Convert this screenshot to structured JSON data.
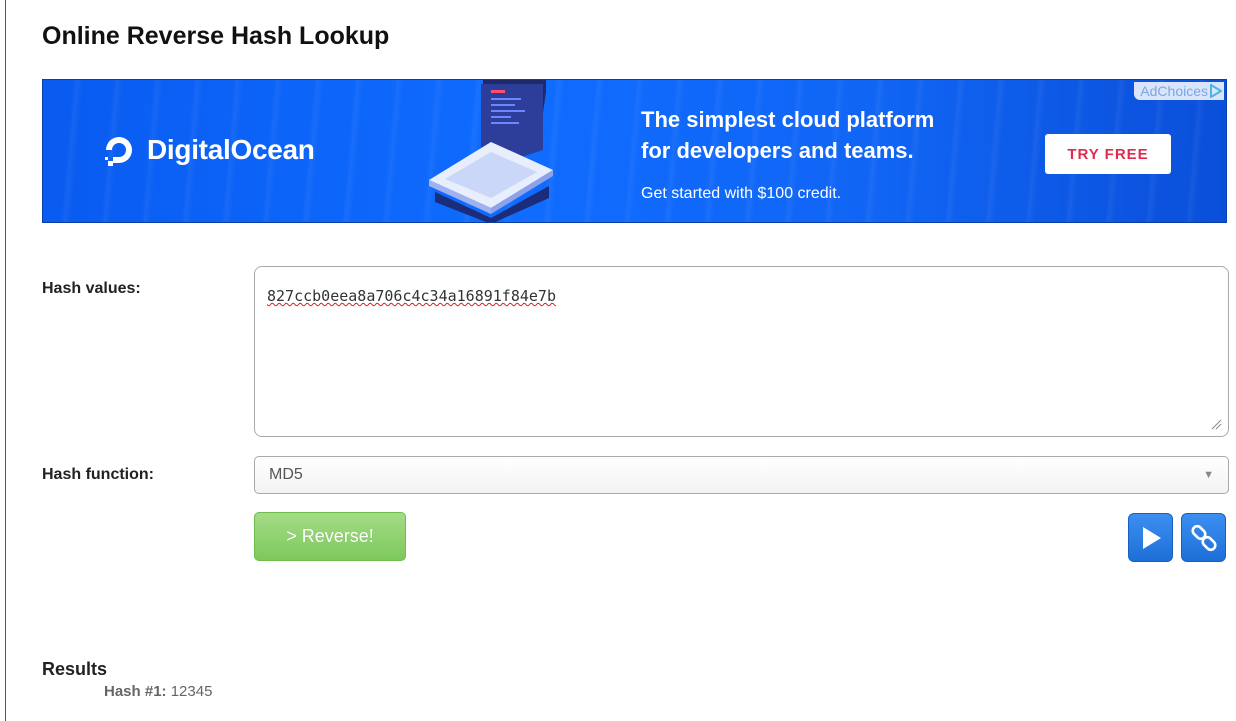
{
  "page": {
    "title": "Online Reverse Hash Lookup"
  },
  "ad": {
    "adchoices_label": "AdChoices",
    "brand": "DigitalOcean",
    "headline_line1": "The simplest cloud platform",
    "headline_line2": "for developers and teams.",
    "subtext": "Get started with $100 credit.",
    "cta_label": "TRY FREE",
    "colors": {
      "background": "#0f6cff",
      "cta_text": "#e12a50"
    }
  },
  "form": {
    "hash_values_label": "Hash values:",
    "hash_values_value": "827ccb0eea8a706c4c34a16891f84e7b",
    "hash_function_label": "Hash function:",
    "hash_function_selected": "MD5",
    "reverse_button_label": "> Reverse!",
    "icons": {
      "play": "play-icon",
      "link": "link-icon"
    },
    "colors": {
      "reverse_button": "#7ec85c",
      "icon_button": "#1d6fd8"
    }
  },
  "results": {
    "title": "Results",
    "items": [
      {
        "label": "Hash #1:",
        "value": "12345"
      }
    ]
  }
}
